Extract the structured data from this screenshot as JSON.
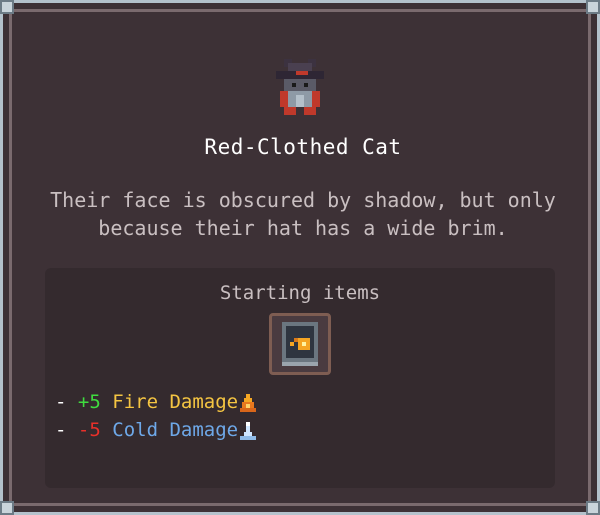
{
  "character": {
    "name": "Red-Clothed Cat",
    "description_lines": [
      "Their face is obscured by shadow, but only",
      "because their hat has a wide brim."
    ]
  },
  "starting_items": {
    "title": "Starting items",
    "item_icon": "fire-spellbook-icon",
    "stats": [
      {
        "dash": "-",
        "value": "+5",
        "value_color": "#3fdc3f",
        "label": "Fire Damage",
        "label_color": "#f5c542",
        "icon": "fire-icon"
      },
      {
        "dash": "-",
        "value": "-5",
        "value_color": "#e8302a",
        "label": "Cold Damage",
        "label_color": "#6ea8e8",
        "icon": "snow-icon"
      }
    ]
  },
  "colors": {
    "panel": "#3d3136",
    "inner_box": "#342a2e",
    "frame": "#b4c2cc"
  }
}
